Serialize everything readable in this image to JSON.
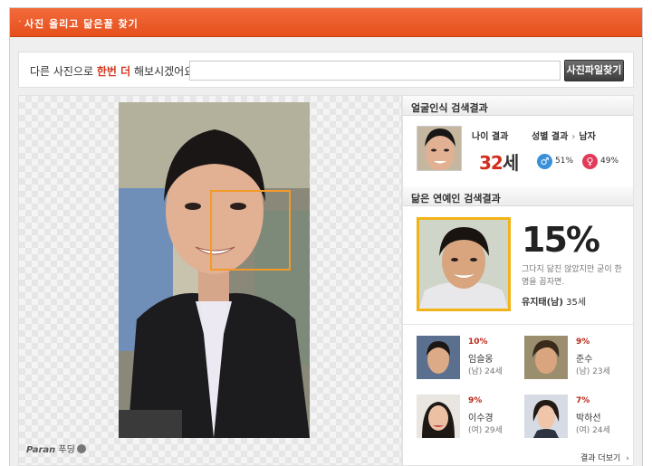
{
  "titlebar": {
    "title": "사진 올리고 닮은꼴 찾기"
  },
  "search": {
    "label_pre": "다른 사진으로 ",
    "label_highlight": "한번 더",
    "label_post": " 해보시겠어요?",
    "file_value": "",
    "button_label": "사진파일찾기"
  },
  "brand": {
    "paran": "Paran",
    "pudding": "푸딩"
  },
  "face_result": {
    "section_title": "얼굴인식 검색결과",
    "age_label": "나이 결과",
    "age_value": "32",
    "age_unit": "세",
    "gender_label": "성별 결과",
    "gender_value": "남자",
    "male_pct": "51%",
    "female_pct": "49%"
  },
  "celeb_result": {
    "section_title": "닮은 연예인 검색결과",
    "top": {
      "pct": "15%",
      "desc": "그다지 닮진 않았지만 굳이 한명을 꼽자면.",
      "name": "유지태(남)",
      "age": "35세"
    },
    "others": [
      {
        "pct": "10%",
        "name": "임슬옹",
        "meta": "(남) 24세"
      },
      {
        "pct": "9%",
        "name": "준수",
        "meta": "(남) 23세"
      },
      {
        "pct": "9%",
        "name": "이수경",
        "meta": "(여) 29세"
      },
      {
        "pct": "7%",
        "name": "박하선",
        "meta": "(여) 24세"
      }
    ],
    "more_label": "결과 더보기"
  },
  "colors": {
    "accent": "#e5501d",
    "highlight": "#d4361f",
    "frame": "#f2b318",
    "face_box": "#f39a2b"
  },
  "icons": {
    "male": "male-symbol",
    "female": "female-symbol",
    "more": "chevron-right"
  }
}
